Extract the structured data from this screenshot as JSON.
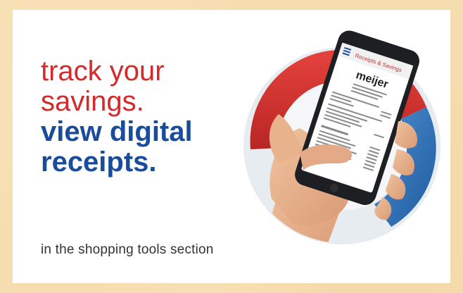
{
  "ad": {
    "line1": "track your",
    "line2": "savings.",
    "line3": "view digital",
    "line4": "receipts.",
    "subtext": "in the shopping tools section"
  },
  "phone": {
    "app_header": "Receipts & Savings",
    "store_logo": "meijer",
    "menu_icon": "hamburger-icon"
  },
  "colors": {
    "red": "#d42a2a",
    "blue": "#1a4c9c",
    "ring_red": "#d93a36",
    "ring_blue": "#2f6fb6",
    "background": "#f6ddb0"
  }
}
